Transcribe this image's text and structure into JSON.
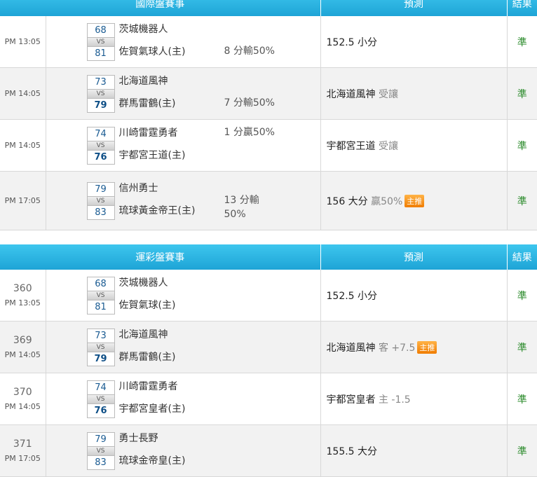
{
  "headers": {
    "intl_title": "國際盤賽事",
    "lottery_title": "運彩盤賽事",
    "prediction": "預測",
    "result": "結果"
  },
  "intl": [
    {
      "time": "PM 13:05",
      "away": "茨城機器人",
      "home": "佐賀氣球人(主)",
      "away_score": "68",
      "home_score": "81",
      "vs": "VS",
      "winner": "none",
      "odds": "8 分輸50%",
      "odds_pos": "home",
      "pred_main": "152.5 小分",
      "pred_sub": "",
      "badge": "",
      "result": "準"
    },
    {
      "time": "PM 14:05",
      "away": "北海道風神",
      "home": "群馬雷鶴(主)",
      "away_score": "73",
      "home_score": "79",
      "vs": "VS",
      "winner": "home",
      "odds": "7 分輸50%",
      "odds_pos": "home",
      "pred_main": "北海道風神",
      "pred_sub": "受讓",
      "badge": "",
      "result": "準"
    },
    {
      "time": "PM 14:05",
      "away": "川崎雷霆勇者",
      "home": "宇都宮王道(主)",
      "away_score": "74",
      "home_score": "76",
      "vs": "VS",
      "winner": "home",
      "odds": "1 分贏50%",
      "odds_pos": "away",
      "pred_main": "宇都宮王道",
      "pred_sub": "受讓",
      "badge": "",
      "result": "準"
    },
    {
      "time": "PM 17:05",
      "away": "信州勇士",
      "home": "琉球黃金帝王(主)",
      "away_score": "79",
      "home_score": "83",
      "vs": "VS",
      "winner": "none",
      "odds": "13 分輸",
      "odds2": "50%",
      "odds_pos": "split",
      "pred_main": "156 大分",
      "pred_sub": "贏50%",
      "badge": "主推",
      "result": "準"
    }
  ],
  "lottery": [
    {
      "num": "360",
      "time": "PM 13:05",
      "away": "茨城機器人",
      "home": "佐賀氣球(主)",
      "away_score": "68",
      "home_score": "81",
      "vs": "VS",
      "winner": "none",
      "pred_main": "152.5 小分",
      "pred_sub": "",
      "badge": "",
      "result": "準"
    },
    {
      "num": "369",
      "time": "PM 14:05",
      "away": "北海道風神",
      "home": "群馬雷鶴(主)",
      "away_score": "73",
      "home_score": "79",
      "vs": "VS",
      "winner": "home",
      "pred_main": "北海道風神",
      "pred_sub": "客 +7.5",
      "badge": "主推",
      "result": "準"
    },
    {
      "num": "370",
      "time": "PM 14:05",
      "away": "川崎雷霆勇者",
      "home": "宇都宮皇者(主)",
      "away_score": "74",
      "home_score": "76",
      "vs": "VS",
      "winner": "home",
      "pred_main": "宇都宮皇者",
      "pred_sub": "主 -1.5",
      "badge": "",
      "result": "準"
    },
    {
      "num": "371",
      "time": "PM 17:05",
      "away": "勇士長野",
      "home": "琉球金帝皇(主)",
      "away_score": "79",
      "home_score": "83",
      "vs": "VS",
      "winner": "none",
      "pred_main": "155.5 大分",
      "pred_sub": "",
      "badge": "",
      "result": "準"
    }
  ]
}
